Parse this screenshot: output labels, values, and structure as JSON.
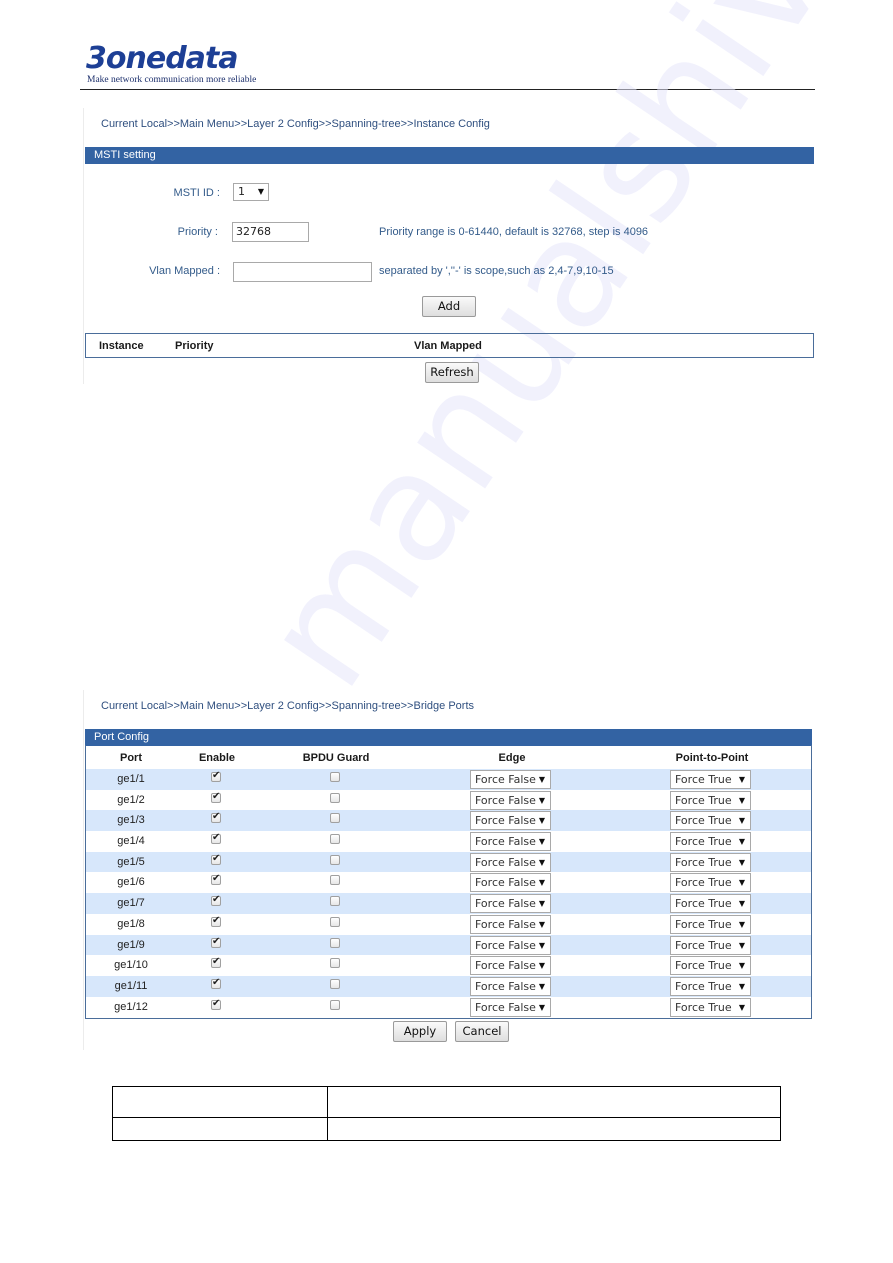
{
  "header": {
    "logo_text": "3onedata",
    "logo_tagline": "Make network communication more reliable"
  },
  "watermark": "manualshive.com",
  "instance_config": {
    "breadcrumb": "Current Local>>Main Menu>>Layer 2 Config>>Spanning-tree>>Instance Config",
    "section_title": "MSTI setting",
    "msti_id": {
      "label": "MSTI ID :",
      "value": "1",
      "icon": "dropdown-arrow-icon"
    },
    "priority": {
      "label": "Priority :",
      "value": "32768",
      "hint": "Priority range is 0-61440, default is 32768, step is 4096"
    },
    "vlan_mapped": {
      "label": "Vlan Mapped :",
      "value": "",
      "hint": "separated by ',''-' is scope,such as 2,4-7,9,10-15"
    },
    "add_label": "Add",
    "table_headers": [
      "Instance",
      "Priority",
      "Vlan Mapped"
    ],
    "rows": [],
    "refresh_label": "Refresh"
  },
  "bridge_ports": {
    "breadcrumb": "Current Local>>Main Menu>>Layer 2 Config>>Spanning-tree>>Bridge Ports",
    "section_title": "Port Config",
    "columns": [
      "Port",
      "Enable",
      "BPDU Guard",
      "Edge",
      "Point-to-Point"
    ],
    "rows": [
      {
        "port": "ge1/1",
        "enable": true,
        "bpdu_guard": false,
        "edge": "Force False",
        "p2p": "Force True"
      },
      {
        "port": "ge1/2",
        "enable": true,
        "bpdu_guard": false,
        "edge": "Force False",
        "p2p": "Force True"
      },
      {
        "port": "ge1/3",
        "enable": true,
        "bpdu_guard": false,
        "edge": "Force False",
        "p2p": "Force True"
      },
      {
        "port": "ge1/4",
        "enable": true,
        "bpdu_guard": false,
        "edge": "Force False",
        "p2p": "Force True"
      },
      {
        "port": "ge1/5",
        "enable": true,
        "bpdu_guard": false,
        "edge": "Force False",
        "p2p": "Force True"
      },
      {
        "port": "ge1/6",
        "enable": true,
        "bpdu_guard": false,
        "edge": "Force False",
        "p2p": "Force True"
      },
      {
        "port": "ge1/7",
        "enable": true,
        "bpdu_guard": false,
        "edge": "Force False",
        "p2p": "Force True"
      },
      {
        "port": "ge1/8",
        "enable": true,
        "bpdu_guard": false,
        "edge": "Force False",
        "p2p": "Force True"
      },
      {
        "port": "ge1/9",
        "enable": true,
        "bpdu_guard": false,
        "edge": "Force False",
        "p2p": "Force True"
      },
      {
        "port": "ge1/10",
        "enable": true,
        "bpdu_guard": false,
        "edge": "Force False",
        "p2p": "Force True"
      },
      {
        "port": "ge1/11",
        "enable": true,
        "bpdu_guard": false,
        "edge": "Force False",
        "p2p": "Force True"
      },
      {
        "port": "ge1/12",
        "enable": true,
        "bpdu_guard": false,
        "edge": "Force False",
        "p2p": "Force True"
      }
    ],
    "apply_label": "Apply",
    "cancel_label": "Cancel"
  },
  "document_table": {
    "rows": [
      [
        "",
        ""
      ],
      [
        "",
        ""
      ]
    ]
  },
  "colors": {
    "section_bar": "#3363a3",
    "row_alt": "#d7e7fb",
    "label_text": "#335b8a",
    "logo": "#1d3f95"
  }
}
